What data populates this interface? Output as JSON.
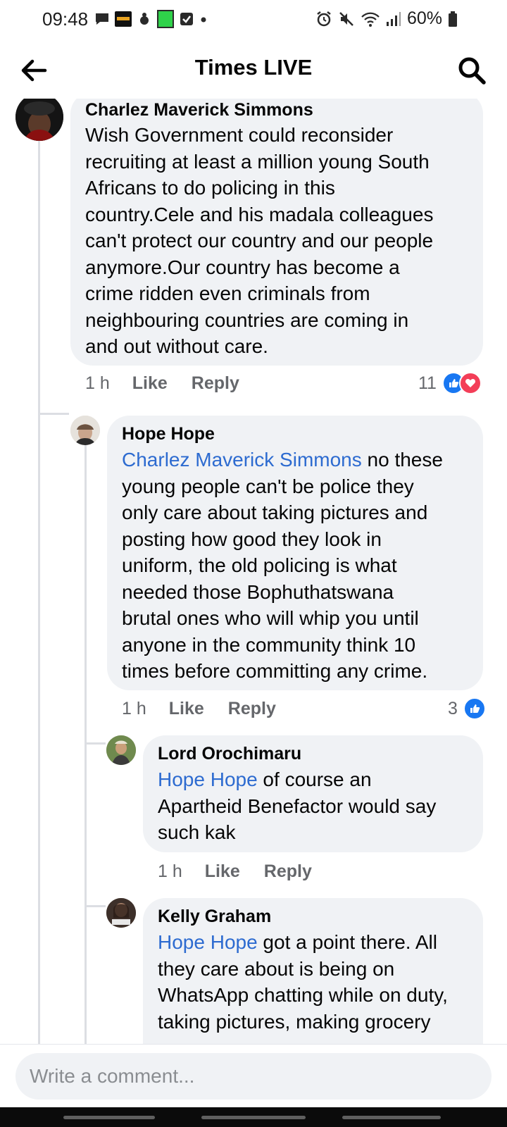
{
  "status_bar": {
    "time": "09:48",
    "battery": "60%"
  },
  "header": {
    "title": "Times LIVE"
  },
  "comments": [
    {
      "author": "Charlez Maverick Simmons",
      "lines": [
        "Wish Government could reconsider",
        "recruiting at least a million young South",
        "Africans to do policing in this",
        "country.Cele and his madala colleagues",
        "can't protect our country and our people",
        "anymore.Our country has become a",
        "crime ridden even criminals from",
        "neighbouring countries are coming in",
        "and out without care."
      ],
      "time": "1 h",
      "like_label": "Like",
      "reply_label": "Reply",
      "reactions": "11"
    },
    {
      "author": "Hope Hope",
      "mention": "Charlez Maverick Simmons",
      "first_line_rest": " no these",
      "lines": [
        "young people can't be police they",
        "only care about taking pictures and",
        "posting how good they look in",
        "uniform, the old policing is what",
        "needed those Bophuthatswana",
        "brutal ones who will whip you until",
        "anyone in the community think 10",
        "times before committing any crime."
      ],
      "time": "1 h",
      "like_label": "Like",
      "reply_label": "Reply",
      "reactions": "3"
    },
    {
      "author": "Lord Orochimaru",
      "mention": "Hope Hope",
      "first_line_rest": " of course an",
      "lines": [
        "Apartheid Benefactor would say",
        "such kak"
      ],
      "time": "1 h",
      "like_label": "Like",
      "reply_label": "Reply"
    },
    {
      "author": "Kelly Graham",
      "mention": "Hope Hope",
      "first_line_rest": " got a point there. All",
      "lines": [
        "they care about is being on",
        "WhatsApp chatting while on duty,",
        "taking pictures, making grocery"
      ]
    }
  ],
  "composer": {
    "placeholder": "Write a comment..."
  },
  "colors": {
    "link": "#2d6bd0",
    "bubble": "#f0f2f5",
    "like": "#1877f2",
    "love": "#f33e58"
  }
}
